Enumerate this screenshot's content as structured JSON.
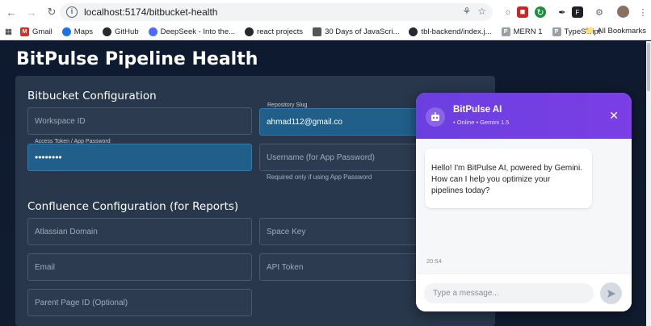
{
  "browser": {
    "url": "localhost:5174/bitbucket-health",
    "bookmarks": [
      {
        "label": "Gmail",
        "color": "#d93025"
      },
      {
        "label": "Maps",
        "color": "#1a73e8"
      },
      {
        "label": "GitHub",
        "color": "#24292f"
      },
      {
        "label": "DeepSeek - Into the...",
        "color": "#4d6bfe"
      },
      {
        "label": "react projects",
        "color": "#24292f"
      },
      {
        "label": "30 Days of JavaScri...",
        "color": "#555555"
      },
      {
        "label": "tbl-backend/index.j...",
        "color": "#24292f"
      },
      {
        "label": "MERN 1",
        "color": "#9aa0a6"
      },
      {
        "label": "TypeScript",
        "color": "#9aa0a6"
      }
    ],
    "all_bookmarks": "All Bookmarks"
  },
  "page": {
    "title": "BitPulse Pipeline Health",
    "bitbucket": {
      "title": "Bitbucket Configuration",
      "workspace_placeholder": "Workspace ID",
      "repo_label": "Repository Slug",
      "repo_value": "ahmad112@gmail.co",
      "token_label": "Access Token / App Password",
      "token_value": "••••••••",
      "username_placeholder": "Username (for App Password)",
      "username_hint": "Required only if using App Password"
    },
    "confluence": {
      "title": "Confluence Configuration (for Reports)",
      "domain_placeholder": "Atlassian Domain",
      "space_placeholder": "Space Key",
      "email_placeholder": "Email",
      "token_placeholder": "API Token",
      "parent_placeholder": "Parent Page ID (Optional)"
    }
  },
  "chat": {
    "name": "BitPulse AI",
    "status": "• Online • Gemini 1.5",
    "close_glyph": "✕",
    "message": "Hello! I'm BitPulse AI, powered by Gemini. How can I help you optimize your pipelines today?",
    "time": "20:54",
    "input_placeholder": "Type a message...",
    "accent": "#6a3fe0"
  }
}
